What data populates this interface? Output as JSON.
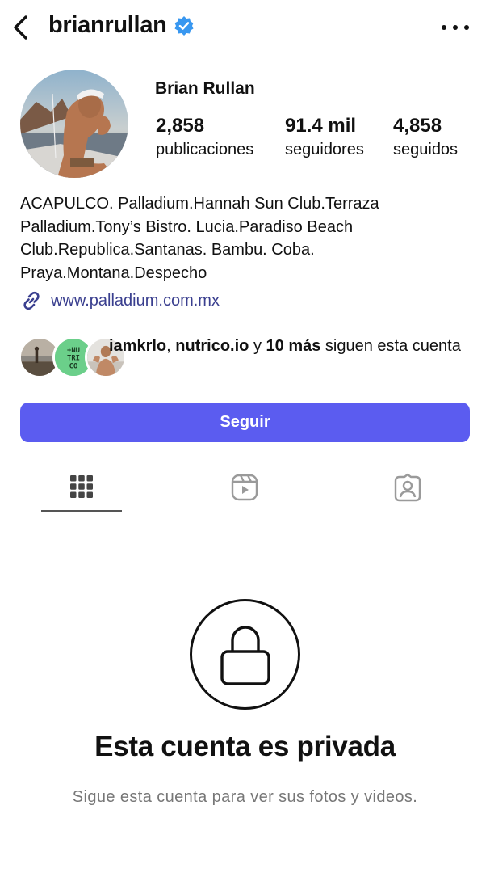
{
  "header": {
    "username": "brianrullan",
    "verified": true,
    "icons": {
      "back": "chevron-left-icon",
      "verified": "verified-badge-icon",
      "more": "more-horizontal-icon"
    }
  },
  "profile": {
    "display_name": "Brian Rullan",
    "stats": {
      "posts": {
        "value": "2,858",
        "label": "publicaciones"
      },
      "followers": {
        "value": "91.4 mil",
        "label": "seguidores"
      },
      "following": {
        "value": "4,858",
        "label": "seguidos"
      }
    },
    "bio": "ACAPULCO. Palladium.Hannah Sun Club.Terraza\nPalladium.Tony’s Bistro. Lucia.Paradiso Beach\nClub.Republica.Santanas. Bambu. Coba.\nPraya.Montana.Despecho",
    "link": {
      "icon": "link-icon",
      "text": "www.palladium.com.mx"
    }
  },
  "mutual_followers": {
    "name1": "iamkrlo",
    "sep": ", ",
    "name2": "nutrico.io",
    "and": " y ",
    "more": "10 más",
    "suffix": " siguen esta cuenta",
    "badge_text": "+NU TRI CO"
  },
  "actions": {
    "follow_label": "Seguir"
  },
  "tabs": [
    {
      "name": "grid",
      "icon": "grid-icon",
      "active": true
    },
    {
      "name": "reels",
      "icon": "reels-icon",
      "active": false
    },
    {
      "name": "tagged",
      "icon": "tagged-user-icon",
      "active": false
    }
  ],
  "private_notice": {
    "icon": "lock-icon",
    "title": "Esta cuenta es privada",
    "subtitle": "Sigue esta cuenta para ver sus fotos y videos."
  },
  "colors": {
    "follow_button": "#5b5cf0",
    "verified_badge": "#3897f0",
    "link_text": "#3a3f8f",
    "muted_text": "#777777"
  }
}
